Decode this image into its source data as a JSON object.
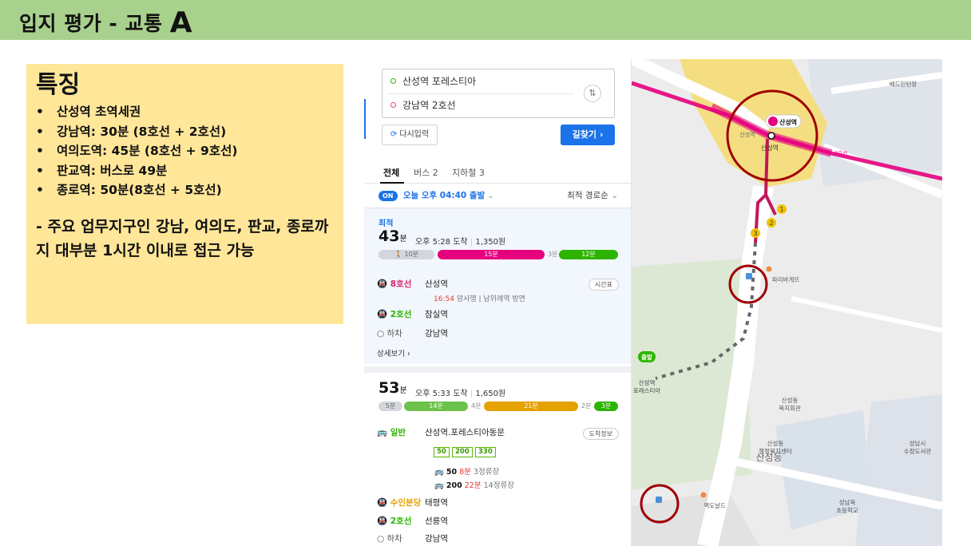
{
  "header": {
    "title": "입지 평가 - 교통",
    "title_mark": "A"
  },
  "features": {
    "title": "특징",
    "items": [
      "산성역 초역세권",
      "강남역: 30분 (8호선 + 2호선)",
      "여의도역: 45분 (8호선 + 9호선)",
      "판교역: 버스로 49분",
      "종로역: 50분(8호선 + 5호선)"
    ],
    "note": "- 주요 업무지구인 강남, 여의도, 판교, 종로까지 대부분 1시간 이내로 접근 가능"
  },
  "search": {
    "origin": "산성역 포레스티아",
    "destination": "강남역 2호선",
    "reset_label": "다시입력",
    "find_label": "길찾기"
  },
  "tabs": [
    "전체",
    "버스 2",
    "지하철 3"
  ],
  "depart": {
    "on_badge": "ON",
    "text": "오늘 오후 04:40 출발",
    "sort": "최적 경로순"
  },
  "route1": {
    "tag": "최적",
    "minutes": "43",
    "unit": "분",
    "arrive": "오후 5:28 도착",
    "fare": "1,350원",
    "segments": [
      "10분",
      "15분",
      "3분",
      "12분"
    ],
    "steps": [
      {
        "line": "8호선",
        "stop": "산성역",
        "sub_time": "16:54",
        "sub_text": "암사행 | 남위례역 방면",
        "button": "시간표"
      },
      {
        "line": "2호선",
        "stop": "잠실역"
      },
      {
        "line": "하차",
        "stop": "강남역"
      }
    ],
    "detail": "상세보기"
  },
  "route2": {
    "minutes": "53",
    "unit": "분",
    "arrive": "오후 5:33 도착",
    "fare": "1,650원",
    "segments": [
      "5분",
      "14분",
      "4분",
      "21분",
      "2분",
      "3분"
    ],
    "steps": [
      {
        "line": "일반",
        "stop": "산성역.포레스티아동문",
        "button": "도착정보"
      },
      {
        "line": "수인분당",
        "stop": "태평역"
      },
      {
        "line": "2호선",
        "stop": "선릉역"
      },
      {
        "line": "하차",
        "stop": "강남역"
      }
    ],
    "bus_chips": [
      "50",
      "200",
      "330"
    ],
    "bus_arrivals": [
      {
        "no": "50",
        "time": "8분",
        "stops": "3정류장"
      },
      {
        "no": "200",
        "time": "22분",
        "stops": "14정류장"
      }
    ]
  },
  "map": {
    "labels": {
      "station": "산성역",
      "station_sub": "산성역",
      "station_small": "산성역",
      "depot": "배드민턴장",
      "cafe": "파리바게뜨",
      "start_badge": "출발",
      "start_place": "산성역",
      "start_place2": "포레스티아",
      "welfare": "산성동",
      "welfare2": "복지회관",
      "admin": "산성동",
      "admin2": "행정복지센터",
      "dong": "산성동",
      "library": "성남시",
      "library2": "수정도서관",
      "school": "성남북",
      "school2": "초등학교",
      "mcd": "맥도날드",
      "exit_line": "8호선"
    },
    "colors": {
      "line8": "#e6007e",
      "line2": "#2db400",
      "circle": "#a00000"
    }
  }
}
